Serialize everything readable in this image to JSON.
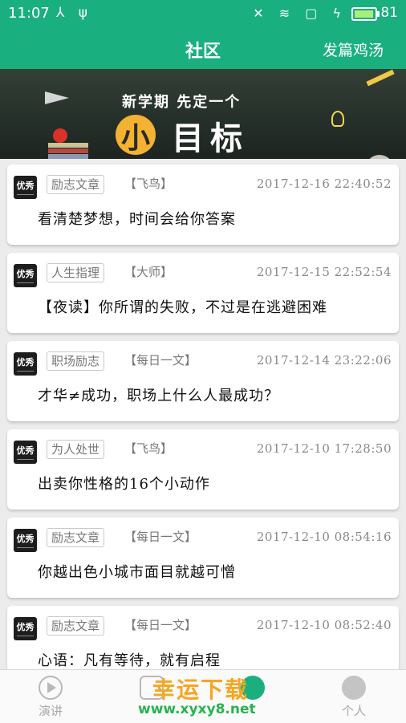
{
  "status_bar": {
    "time": "11:07",
    "battery": "81"
  },
  "header": {
    "title": "社区",
    "post_button": "发篇鸡汤"
  },
  "banner": {
    "headline": "新学期 先定一个",
    "goal_small": "小",
    "goal_big": "目标"
  },
  "posts": [
    {
      "tag": "励志文章",
      "author": "【飞鸟】",
      "time": "2017-12-16 22:40:52",
      "text": "看清楚梦想，时间会给你答案",
      "logo": "优秀"
    },
    {
      "tag": "人生指理",
      "author": "【大师】",
      "time": "2017-12-15 22:52:54",
      "text": "【夜读】你所谓的失败，不过是在逃避困难",
      "logo": "优秀"
    },
    {
      "tag": "职场励志",
      "author": "【每日一文】",
      "time": "2017-12-14 23:22:06",
      "text": "才华≠成功，职场上什么人最成功？",
      "logo": "优秀"
    },
    {
      "tag": "为人处世",
      "author": "【飞鸟】",
      "time": "2017-12-10 17:28:50",
      "text": "出卖你性格的16个小动作",
      "logo": "优秀"
    },
    {
      "tag": "励志文章",
      "author": "【每日一文】",
      "time": "2017-12-10 08:54:16",
      "text": "你越出色小城市面目就越可憎",
      "logo": "优秀"
    },
    {
      "tag": "励志文章",
      "author": "【每日一文】",
      "time": "2017-12-10 08:52:40",
      "text": "心语：凡有等待，就有启程",
      "logo": "优秀"
    }
  ],
  "tabs": [
    {
      "label": "演讲",
      "icon": "play-icon"
    },
    {
      "label": "",
      "icon": "article-icon"
    },
    {
      "label": "",
      "icon": "community-icon"
    },
    {
      "label": "个人",
      "icon": "person-icon"
    }
  ],
  "watermark": {
    "title": "幸运下载",
    "url": "www.xyxy8.net"
  },
  "colors": {
    "accent": "#1aaf7f",
    "background": "#ececec"
  }
}
